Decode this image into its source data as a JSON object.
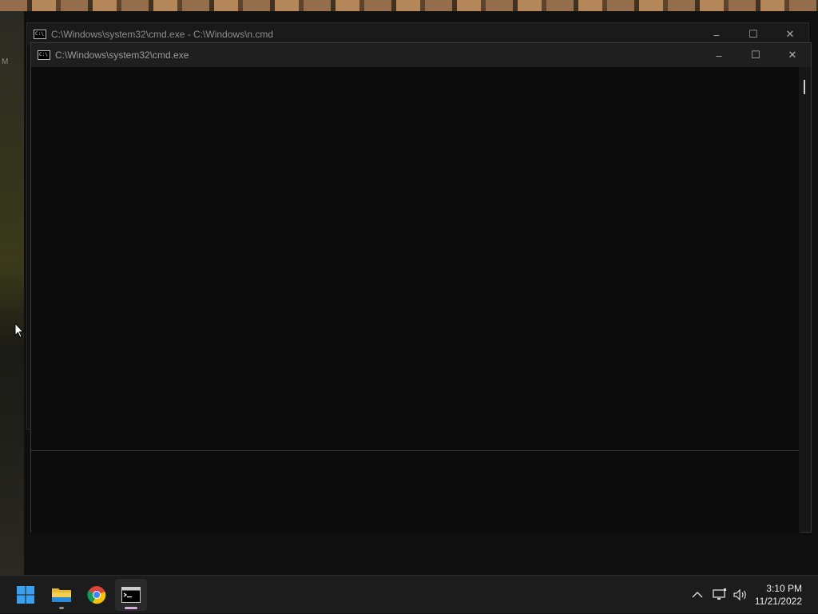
{
  "desktop": {
    "edge_label": "M"
  },
  "back_window": {
    "title": "C:\\Windows\\system32\\cmd.exe - C:\\Windows\\n.cmd",
    "icon": "cmd-icon",
    "controls": {
      "minimize": "–",
      "maximize": "☐",
      "close": "✕"
    }
  },
  "front_window": {
    "title": "C:\\Windows\\system32\\cmd.exe",
    "icon": "cmd-icon",
    "controls": {
      "minimize": "–",
      "maximize": "☐",
      "close": "✕"
    },
    "console_text": ""
  },
  "taskbar": {
    "apps": [
      {
        "name": "start",
        "icon": "windows-logo-icon"
      },
      {
        "name": "file-explorer",
        "icon": "folder-icon"
      },
      {
        "name": "chrome",
        "icon": "chrome-icon"
      },
      {
        "name": "command-prompt",
        "icon": "cmd-icon",
        "active": true
      }
    ],
    "tray": {
      "chevron": "^",
      "icons": [
        "network-icon",
        "volume-icon"
      ]
    },
    "clock": {
      "time": "3:10 PM",
      "date": "11/21/2022"
    }
  },
  "colors": {
    "console_bg": "#0c0c0c",
    "taskbar_bg": "#1c1c1c",
    "titlebar_bg": "#1f1f1f",
    "windows_blue": "#1e90ff"
  }
}
